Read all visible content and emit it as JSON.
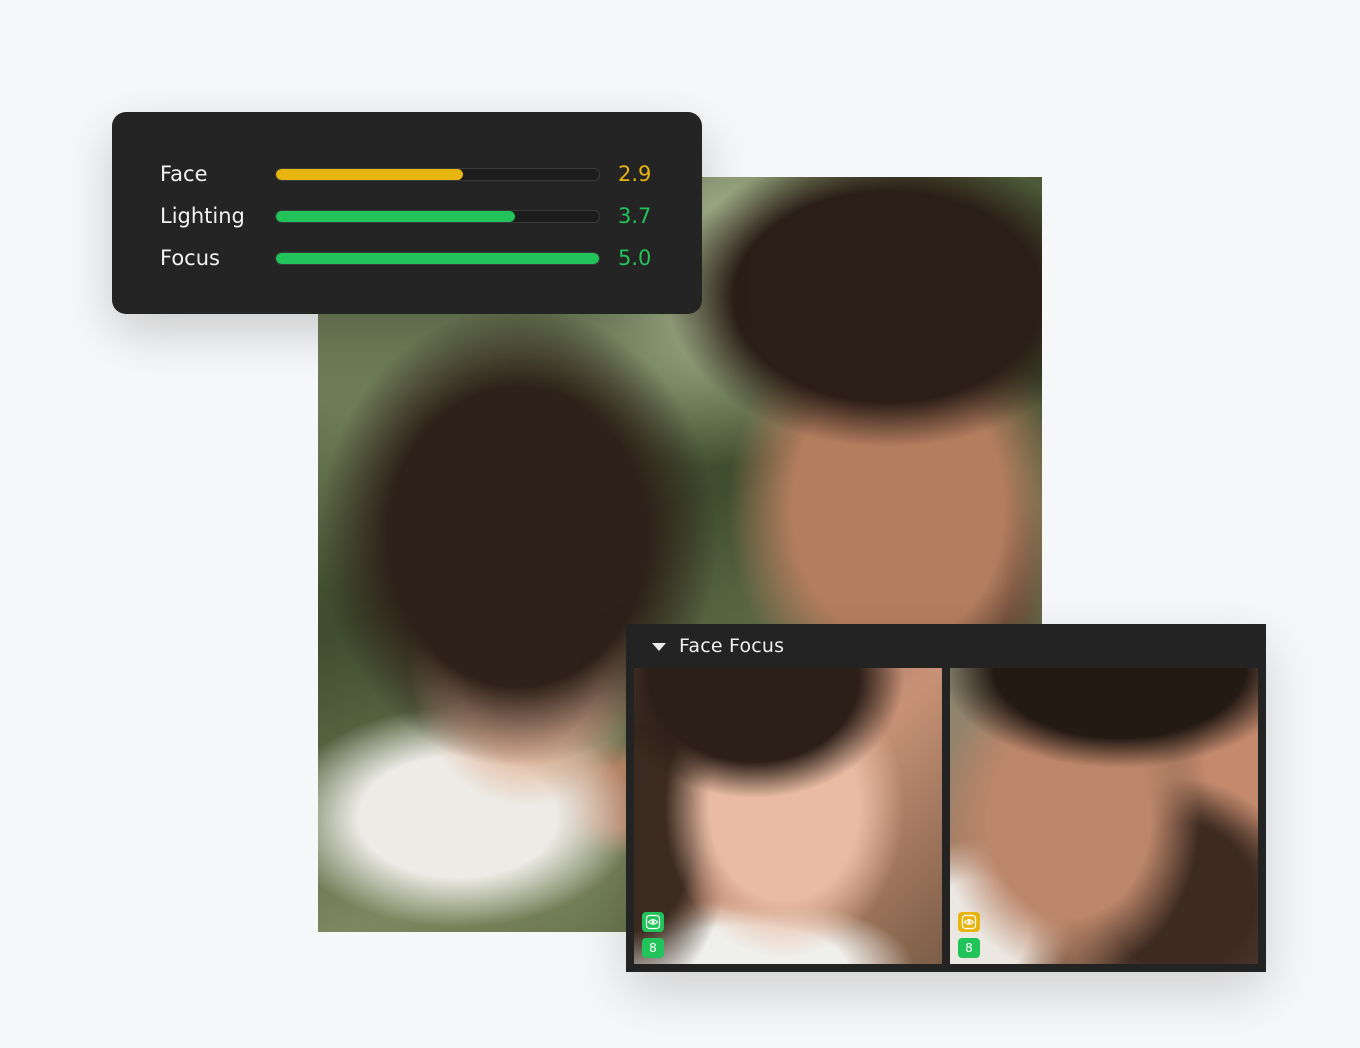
{
  "scores": {
    "items": [
      {
        "label": "Face",
        "value": "2.9",
        "level": 0.58,
        "color": "#e8b40f"
      },
      {
        "label": "Lighting",
        "value": "3.7",
        "level": 0.74,
        "color": "#22c35a"
      },
      {
        "label": "Focus",
        "value": "5.0",
        "level": 1.0,
        "color": "#22c35a"
      }
    ]
  },
  "face_focus": {
    "title": "Face Focus",
    "faces": [
      {
        "name": "woman",
        "eye_badge_color": "#22c35a",
        "count": "8"
      },
      {
        "name": "man",
        "eye_badge_color": "#e8b40f",
        "count": "8"
      }
    ]
  },
  "icons": {
    "collapse": "triangle-down-icon",
    "eye": "eye-icon"
  },
  "colors": {
    "warning": "#e8b40f",
    "success": "#22c35a",
    "panel_bg": "#242424"
  }
}
